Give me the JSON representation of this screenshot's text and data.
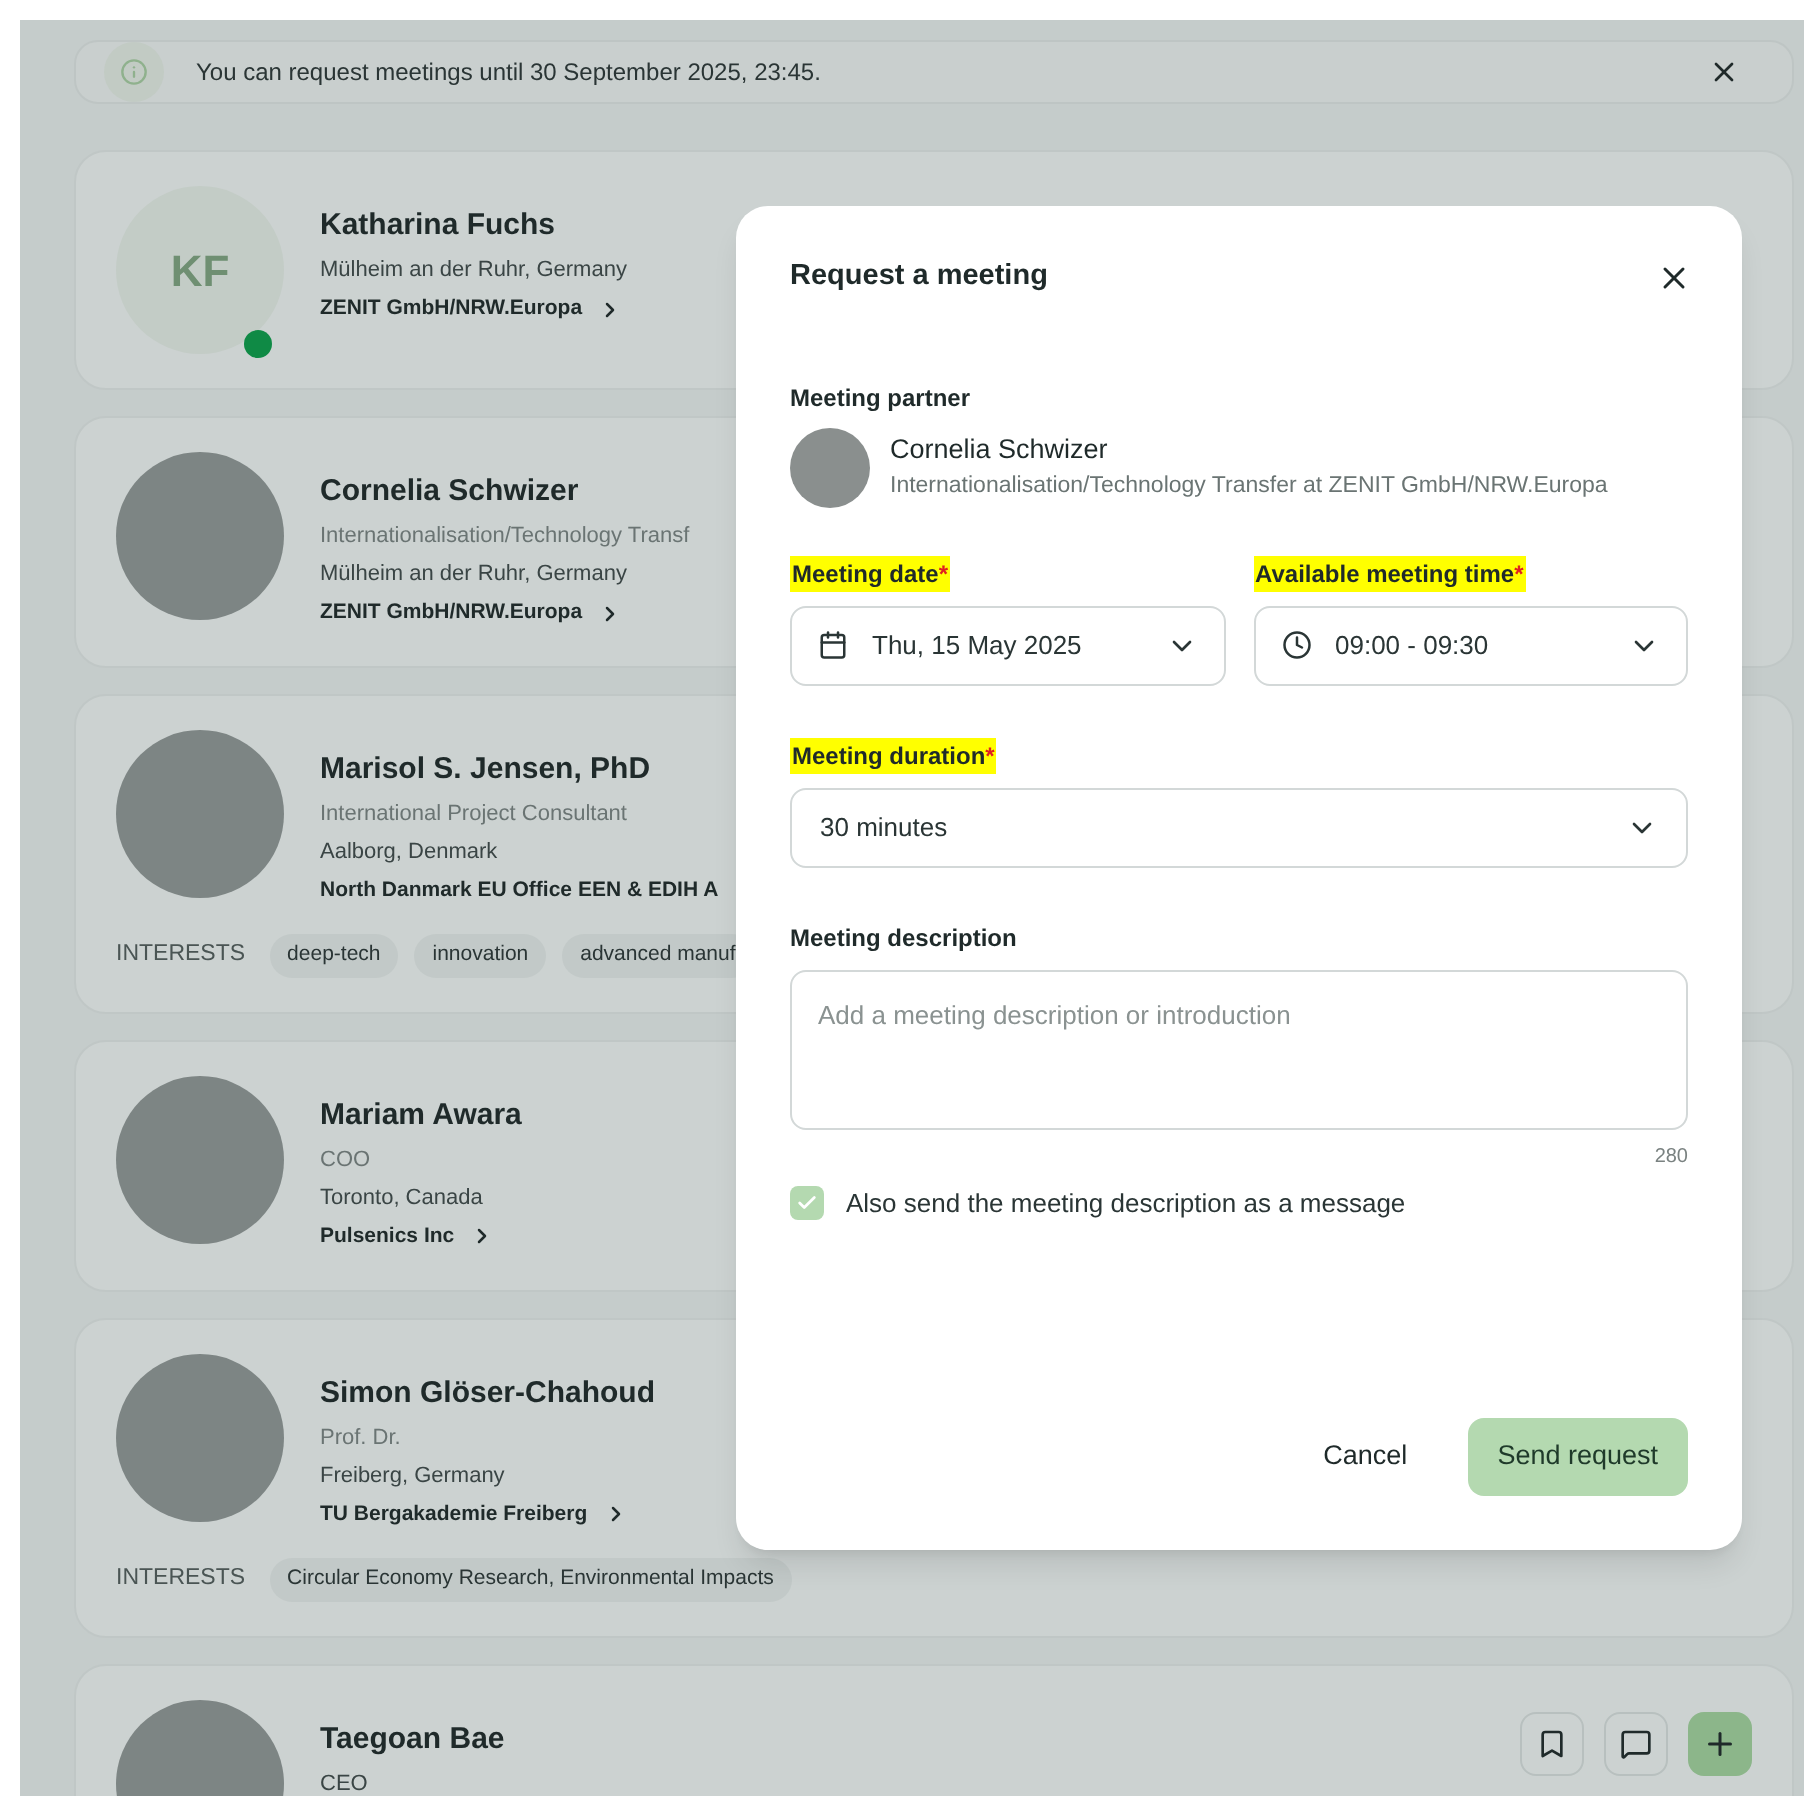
{
  "notice": {
    "text": "You can request meetings until 30 September 2025, 23:45."
  },
  "people": [
    {
      "name": "Katharina Fuchs",
      "kind": "initials",
      "initials": "KF",
      "online": true,
      "lines": [
        "Mülheim an der Ruhr, Germany"
      ],
      "organization": "ZENIT GmbH/NRW.Europa"
    },
    {
      "name": "Cornelia Schwizer",
      "kind": "photo",
      "online": false,
      "lines": [
        "Internationalisation/Technology Transf",
        "Mülheim an der Ruhr, Germany"
      ],
      "organization": "ZENIT GmbH/NRW.Europa"
    },
    {
      "name": "Marisol S. Jensen, PhD",
      "kind": "photo",
      "online": false,
      "lines": [
        "International Project Consultant",
        "Aalborg, Denmark"
      ],
      "organization": "North Danmark EU Office EEN & EDIH A",
      "interests_label": "INTERESTS",
      "interests": [
        "deep-tech",
        "innovation",
        "advanced manuf"
      ]
    },
    {
      "name": "Mariam Awara",
      "kind": "photo",
      "online": false,
      "lines": [
        "COO",
        "Toronto, Canada"
      ],
      "organization": "Pulsenics Inc"
    },
    {
      "name": "Simon Glöser-Chahoud",
      "kind": "photo",
      "online": false,
      "lines": [
        "Prof. Dr.",
        "Freiberg, Germany"
      ],
      "organization": "TU Bergakademie Freiberg",
      "interests_label": "INTERESTS",
      "interests": [
        "Circular Economy Research, Environmental Impacts"
      ]
    },
    {
      "name": "Taegoan Bae",
      "kind": "photo",
      "online": false,
      "lines": [
        "CEO"
      ],
      "actions": true
    }
  ],
  "dialog": {
    "title": "Request a meeting",
    "partner_label": "Meeting partner",
    "partner": {
      "name": "Cornelia Schwizer",
      "role": "Internationalisation/Technology Transfer at ZENIT GmbH/NRW.Europa"
    },
    "date": {
      "label": "Meeting date",
      "required_mark": "*",
      "highlighted": true,
      "value": "Thu, 15 May 2025"
    },
    "time": {
      "label": "Available meeting time",
      "required_mark": "*",
      "highlighted": true,
      "value": "09:00 - 09:30"
    },
    "duration": {
      "label": "Meeting duration",
      "required_mark": "*",
      "highlighted": true,
      "value": "30 minutes"
    },
    "description": {
      "label": "Meeting description",
      "placeholder": "Add a meeting description or introduction",
      "counter": "280"
    },
    "send_as_message": {
      "label": "Also send the meeting description as a message",
      "checked": true
    },
    "buttons": {
      "cancel": "Cancel",
      "send": "Send request"
    }
  }
}
